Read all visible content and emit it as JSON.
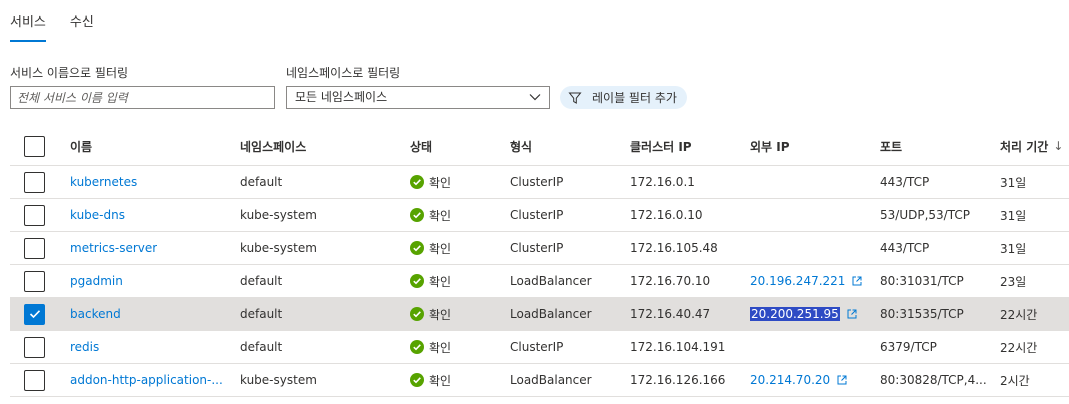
{
  "tabs": [
    {
      "label": "서비스",
      "active": true
    },
    {
      "label": "수신",
      "active": false
    }
  ],
  "filters": {
    "name_label": "서비스 이름으로 필터링",
    "name_placeholder": "전체 서비스 이름 입력",
    "namespace_label": "네임스페이스로 필터링",
    "namespace_value": "모든 네임스페이스",
    "add_label_filter": "레이블 필터 추가"
  },
  "table": {
    "headers": {
      "name": "이름",
      "namespace": "네임스페이스",
      "status": "상태",
      "type": "형식",
      "cluster_ip": "클러스터 IP",
      "external_ip": "외부 IP",
      "ports": "포트",
      "age": "처리 기간",
      "age_sort": "↓"
    },
    "rows": [
      {
        "name": "kubernetes",
        "namespace": "default",
        "status": "확인",
        "type": "ClusterIP",
        "cluster_ip": "172.16.0.1",
        "external_ip": "",
        "ports": "443/TCP",
        "age": "31일",
        "selected": false
      },
      {
        "name": "kube-dns",
        "namespace": "kube-system",
        "status": "확인",
        "type": "ClusterIP",
        "cluster_ip": "172.16.0.10",
        "external_ip": "",
        "ports": "53/UDP,53/TCP",
        "age": "31일",
        "selected": false
      },
      {
        "name": "metrics-server",
        "namespace": "kube-system",
        "status": "확인",
        "type": "ClusterIP",
        "cluster_ip": "172.16.105.48",
        "external_ip": "",
        "ports": "443/TCP",
        "age": "31일",
        "selected": false
      },
      {
        "name": "pgadmin",
        "namespace": "default",
        "status": "확인",
        "type": "LoadBalancer",
        "cluster_ip": "172.16.70.10",
        "external_ip": "20.196.247.221",
        "ports": "80:31031/TCP",
        "age": "23일",
        "selected": false
      },
      {
        "name": "backend",
        "namespace": "default",
        "status": "확인",
        "type": "LoadBalancer",
        "cluster_ip": "172.16.40.47",
        "external_ip": "20.200.251.95",
        "ports": "80:31535/TCP",
        "age": "22시간",
        "selected": true
      },
      {
        "name": "redis",
        "namespace": "default",
        "status": "확인",
        "type": "ClusterIP",
        "cluster_ip": "172.16.104.191",
        "external_ip": "",
        "ports": "6379/TCP",
        "age": "22시간",
        "selected": false
      },
      {
        "name": "addon-http-application-...",
        "namespace": "kube-system",
        "status": "확인",
        "type": "LoadBalancer",
        "cluster_ip": "172.16.126.166",
        "external_ip": "20.214.70.20",
        "ports": "80:30828/TCP,4...",
        "age": "2시간",
        "selected": false
      }
    ]
  },
  "colors": {
    "accent": "#0078d4",
    "status_ok": "#57a300",
    "selection_bg": "#e1dfdd",
    "highlight": "#2e4bc4"
  },
  "icons": {
    "status": "success-check-circle-icon",
    "external_link": "open-external-link-icon",
    "filter": "funnel-filter-icon",
    "dropdown": "chevron-down-icon"
  }
}
